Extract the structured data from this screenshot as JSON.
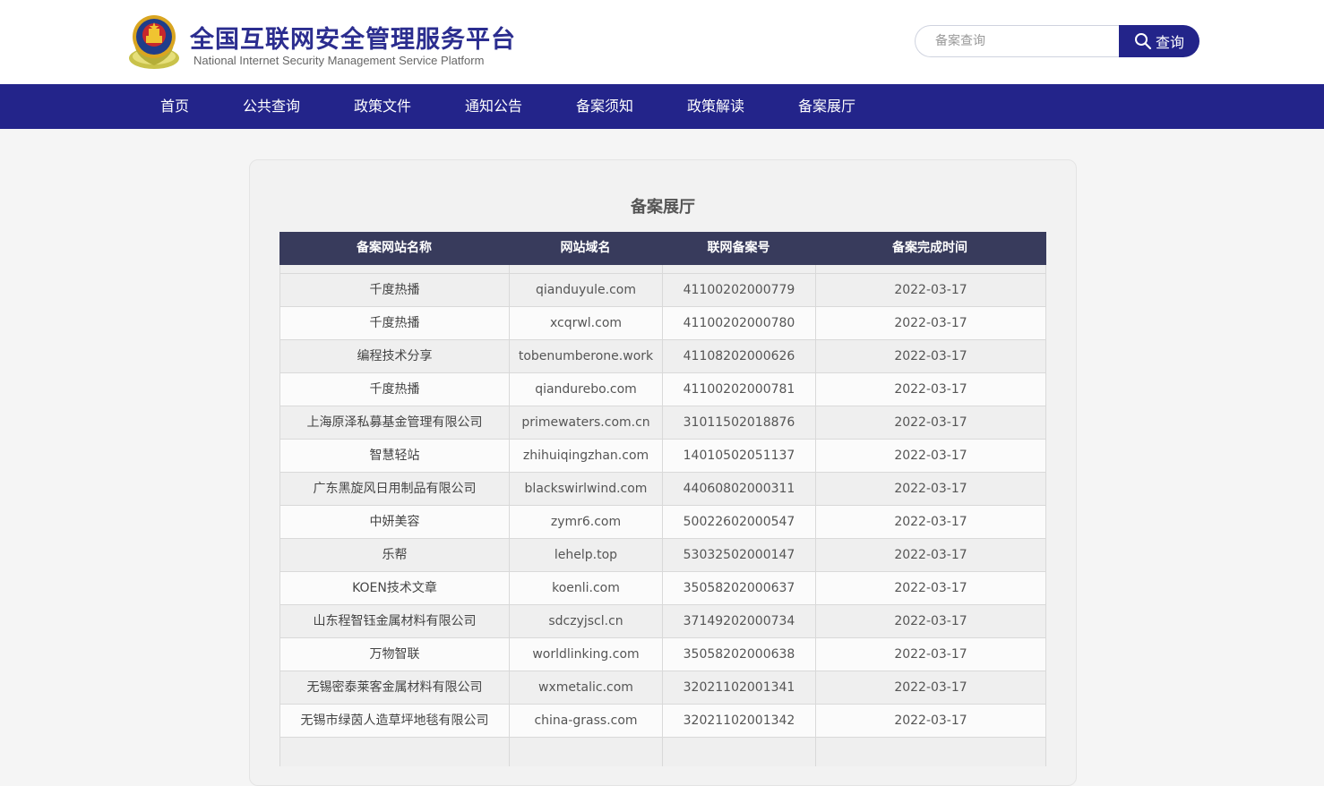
{
  "header": {
    "title": "全国互联网安全管理服务平台",
    "subtitle": "National Internet Security Management Service Platform",
    "search": {
      "placeholder": "备案查询",
      "button_label": "查询"
    }
  },
  "nav": {
    "items": [
      {
        "label": "首页"
      },
      {
        "label": "公共查询"
      },
      {
        "label": "政策文件"
      },
      {
        "label": "通知公告"
      },
      {
        "label": "备案须知"
      },
      {
        "label": "政策解读"
      },
      {
        "label": "备案展厅"
      }
    ]
  },
  "panel": {
    "title": "备案展厅",
    "columns": [
      "备案网站名称",
      "网站域名",
      "联网备案号",
      "备案完成时间"
    ],
    "rows": [
      [
        "千度热播",
        "qianduyule.com",
        "41100202000779",
        "2022-03-17"
      ],
      [
        "千度热播",
        "xcqrwl.com",
        "41100202000780",
        "2022-03-17"
      ],
      [
        "编程技术分享",
        "tobenumberone.work",
        "41108202000626",
        "2022-03-17"
      ],
      [
        "千度热播",
        "qiandurebo.com",
        "41100202000781",
        "2022-03-17"
      ],
      [
        "上海原泽私募基金管理有限公司",
        "primewaters.com.cn",
        "31011502018876",
        "2022-03-17"
      ],
      [
        "智慧轻站",
        "zhihuiqingzhan.com",
        "14010502051137",
        "2022-03-17"
      ],
      [
        "广东黑旋风日用制品有限公司",
        "blackswirlwind.com",
        "44060802000311",
        "2022-03-17"
      ],
      [
        "中妍美容",
        "zymr6.com",
        "50022602000547",
        "2022-03-17"
      ],
      [
        "乐帮",
        "lehelp.top",
        "53032502000147",
        "2022-03-17"
      ],
      [
        "KOEN技术文章",
        "koenli.com",
        "35058202000637",
        "2022-03-17"
      ],
      [
        "山东程智钰金属材料有限公司",
        "sdczyjscl.cn",
        "37149202000734",
        "2022-03-17"
      ],
      [
        "万物智联",
        "worldlinking.com",
        "35058202000638",
        "2022-03-17"
      ],
      [
        "无锡密泰莱客金属材料有限公司",
        "wxmetalic.com",
        "32021102001341",
        "2022-03-17"
      ],
      [
        "无锡市绿茵人造草坪地毯有限公司",
        "china-grass.com",
        "32021102001342",
        "2022-03-17"
      ]
    ]
  }
}
